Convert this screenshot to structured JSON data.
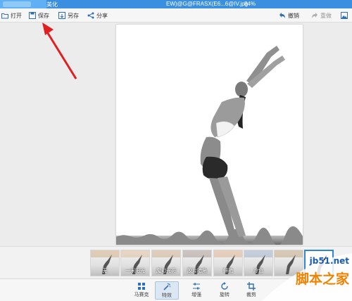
{
  "titlebar": {
    "app_name": "美化",
    "file_name": "EW)@G@FRASX(E6...6@IV.jpg",
    "zoom": "84%"
  },
  "toolbar": {
    "open": "打开",
    "save": "保存",
    "save_as": "另存",
    "share": "分享",
    "undo": "撤销",
    "redo": "重做"
  },
  "filters": [
    {
      "label": "无"
    },
    {
      "label": "一米阳光"
    },
    {
      "label": "魔幻光斑"
    },
    {
      "label": "胶片暗角"
    },
    {
      "label": "鲜艳"
    },
    {
      "label": "冷色"
    },
    {
      "label": ""
    },
    {
      "label": ""
    }
  ],
  "bottom_tools": {
    "mosaic": "马赛克",
    "effects": "特效",
    "enhance": "增强",
    "rotate": "旋转",
    "crop": "裁剪"
  },
  "watermark": {
    "site": "jb51.net",
    "name": "脚本之家"
  },
  "colors": {
    "titlebar": "#3a8fe0",
    "arrow": "#e02020",
    "selected_border": "#2f86d6"
  }
}
